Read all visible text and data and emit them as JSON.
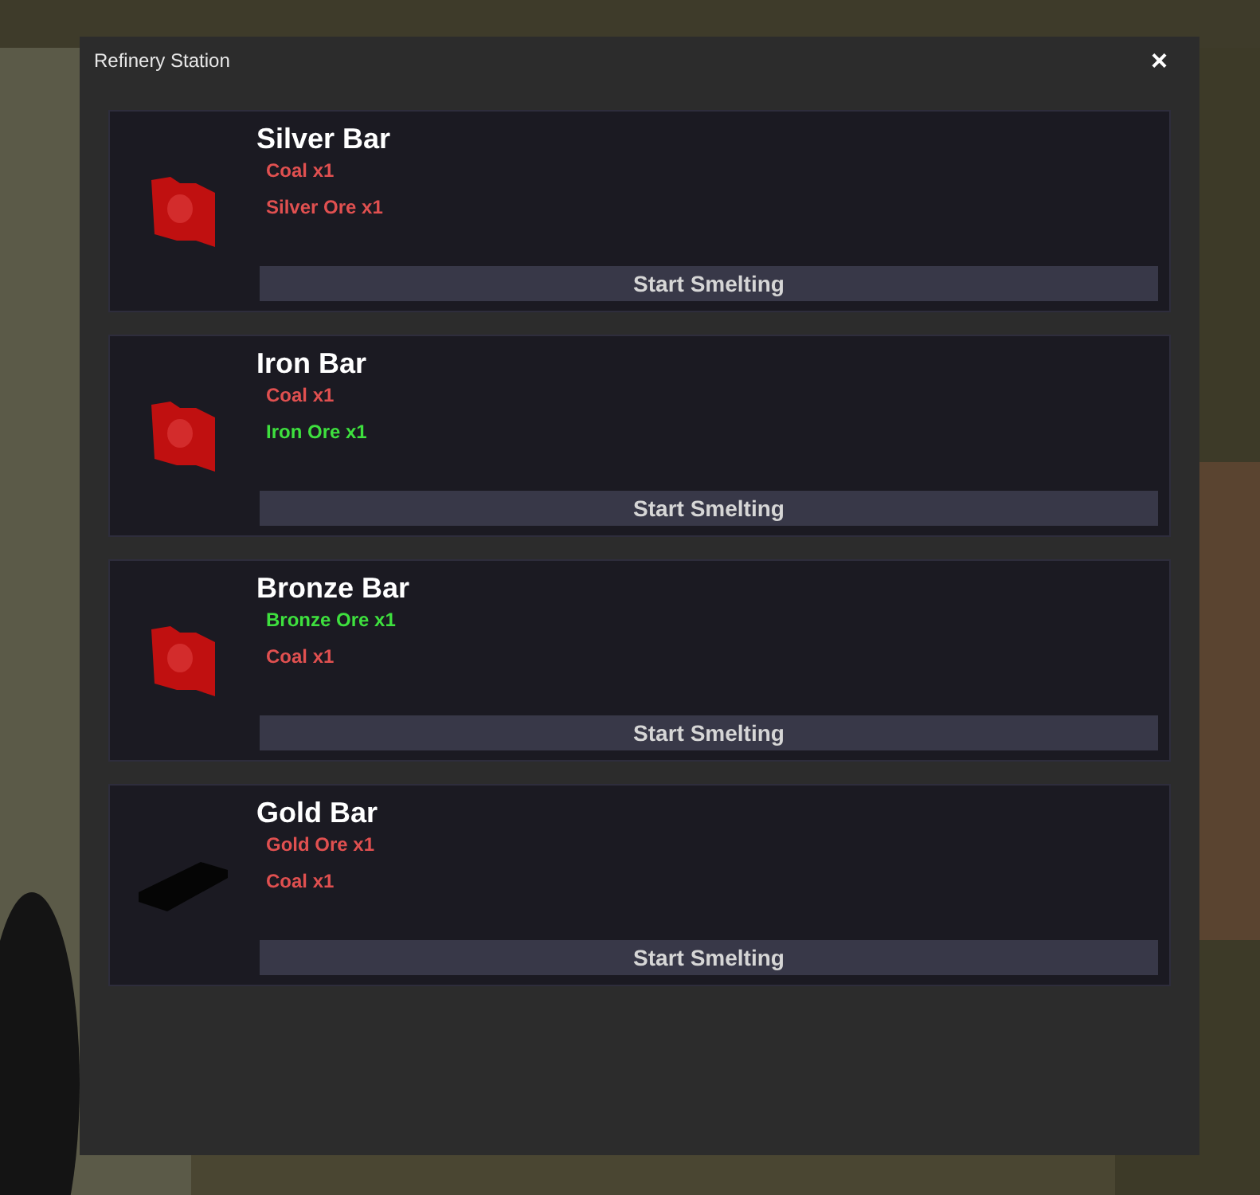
{
  "window": {
    "title": "Refinery Station",
    "close": "×"
  },
  "recipes": [
    {
      "name": "Silver Bar",
      "kind": "red-block",
      "ingredients": [
        {
          "text": "Coal x1",
          "has": false
        },
        {
          "text": "Silver Ore x1",
          "has": false
        }
      ],
      "button": "Start Smelting"
    },
    {
      "name": "Iron Bar",
      "kind": "red-block",
      "ingredients": [
        {
          "text": "Coal x1",
          "has": false
        },
        {
          "text": "Iron Ore x1",
          "has": true
        }
      ],
      "button": "Start Smelting"
    },
    {
      "name": "Bronze Bar",
      "kind": "red-block",
      "ingredients": [
        {
          "text": "Bronze Ore x1",
          "has": true
        },
        {
          "text": "Coal x1",
          "has": false
        }
      ],
      "button": "Start Smelting"
    },
    {
      "name": "Gold Bar",
      "kind": "dark-ingot",
      "ingredients": [
        {
          "text": "Gold Ore x1",
          "has": false
        },
        {
          "text": "Coal x1",
          "has": false
        }
      ],
      "button": "Start Smelting"
    }
  ]
}
